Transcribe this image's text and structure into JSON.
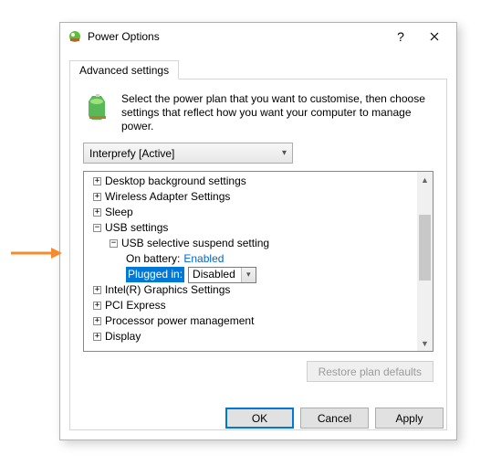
{
  "window": {
    "title": "Power Options",
    "help_label": "?",
    "close_label": "Close"
  },
  "tab": {
    "label": "Advanced settings"
  },
  "intro": {
    "text": "Select the power plan that you want to customise, then choose settings that reflect how you want your computer to manage power."
  },
  "plan_select": {
    "value": "Interprefy [Active]"
  },
  "tree": {
    "items": [
      {
        "label": "Desktop background settings",
        "expandable": "plus",
        "indent": 1
      },
      {
        "label": "Wireless Adapter Settings",
        "expandable": "plus",
        "indent": 1
      },
      {
        "label": "Sleep",
        "expandable": "plus",
        "indent": 1
      },
      {
        "label": "USB settings",
        "expandable": "minus",
        "indent": 1
      },
      {
        "label": "USB selective suspend setting",
        "expandable": "minus",
        "indent": 2
      },
      {
        "label": "On battery:",
        "value": "Enabled",
        "indent": 3,
        "kind": "link"
      },
      {
        "label": "Plugged in:",
        "value": "Disabled",
        "indent": 3,
        "kind": "select",
        "selected": true
      },
      {
        "label": "Intel(R) Graphics Settings",
        "expandable": "plus",
        "indent": 1
      },
      {
        "label": "PCI Express",
        "expandable": "plus",
        "indent": 1
      },
      {
        "label": "Processor power management",
        "expandable": "plus",
        "indent": 1
      },
      {
        "label": "Display",
        "expandable": "plus",
        "indent": 1
      }
    ]
  },
  "restore_button": "Restore plan defaults",
  "buttons": {
    "ok": "OK",
    "cancel": "Cancel",
    "apply": "Apply"
  },
  "glyphs": {
    "plus": "+",
    "minus": "−",
    "chev_down": "▾",
    "up": "▲",
    "down": "▼"
  }
}
